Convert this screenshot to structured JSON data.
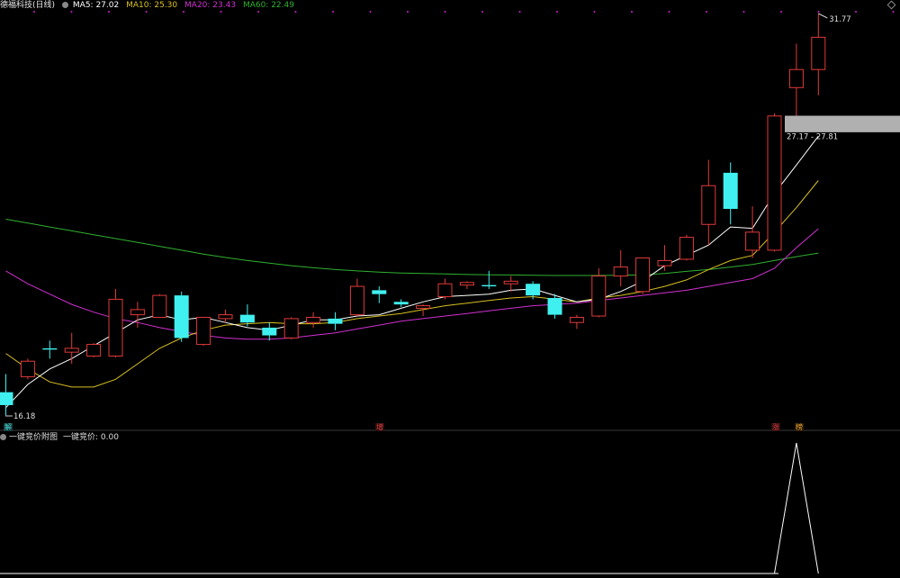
{
  "header": {
    "stock_title": "德福科技(日线)",
    "ma5": "MA5: 27.02",
    "ma10": "MA10: 25.30",
    "ma20": "MA20: 23.43",
    "ma60": "MA60: 22.49"
  },
  "colors": {
    "up": "#e03a3a",
    "down": "#40f0f0",
    "ma5": "#ffffff",
    "ma10": "#d8c020",
    "ma20": "#d030d0",
    "ma60": "#30b030",
    "grid_dot": "#cc22cc",
    "band": "#b0b0b0"
  },
  "annotations": {
    "high_label": "31.77",
    "low_label": "16.18",
    "band_label": "27.17 - 27.81"
  },
  "markers": {
    "left": "解",
    "mid": "增",
    "right1": "涨",
    "right2": "榜"
  },
  "sub_panel": {
    "title": "一键竞价附图",
    "value_label": "一键竞价: 0.00"
  },
  "chart_data": {
    "type": "candlestick",
    "y_range": [
      16.18,
      31.77
    ],
    "candles": [
      {
        "o": 17.1,
        "h": 17.8,
        "l": 16.2,
        "c": 16.6
      },
      {
        "o": 17.7,
        "h": 18.4,
        "l": 17.6,
        "c": 18.3
      },
      {
        "o": 18.8,
        "h": 19.1,
        "l": 18.4,
        "c": 18.75
      },
      {
        "o": 18.65,
        "h": 19.4,
        "l": 18.2,
        "c": 18.8
      },
      {
        "o": 18.5,
        "h": 19.0,
        "l": 18.45,
        "c": 18.95
      },
      {
        "o": 18.5,
        "h": 21.1,
        "l": 18.45,
        "c": 20.7
      },
      {
        "o": 20.1,
        "h": 20.6,
        "l": 19.6,
        "c": 20.3
      },
      {
        "o": 20.0,
        "h": 20.9,
        "l": 20.0,
        "c": 20.85
      },
      {
        "o": 20.85,
        "h": 21.0,
        "l": 19.05,
        "c": 19.2
      },
      {
        "o": 18.95,
        "h": 20.0,
        "l": 18.9,
        "c": 20.0
      },
      {
        "o": 19.95,
        "h": 20.3,
        "l": 19.8,
        "c": 20.1
      },
      {
        "o": 20.1,
        "h": 20.5,
        "l": 19.65,
        "c": 19.8
      },
      {
        "o": 19.6,
        "h": 19.8,
        "l": 19.1,
        "c": 19.3
      },
      {
        "o": 19.2,
        "h": 20.0,
        "l": 19.15,
        "c": 19.95
      },
      {
        "o": 19.8,
        "h": 20.2,
        "l": 19.6,
        "c": 20.0
      },
      {
        "o": 19.95,
        "h": 20.2,
        "l": 19.5,
        "c": 19.75
      },
      {
        "o": 20.1,
        "h": 21.5,
        "l": 20.05,
        "c": 21.2
      },
      {
        "o": 21.05,
        "h": 21.2,
        "l": 20.55,
        "c": 20.9
      },
      {
        "o": 20.6,
        "h": 20.7,
        "l": 20.4,
        "c": 20.5
      },
      {
        "o": 20.35,
        "h": 20.5,
        "l": 20.05,
        "c": 20.45
      },
      {
        "o": 20.8,
        "h": 21.5,
        "l": 20.7,
        "c": 21.3
      },
      {
        "o": 21.25,
        "h": 21.4,
        "l": 21.1,
        "c": 21.35
      },
      {
        "o": 21.25,
        "h": 21.8,
        "l": 21.1,
        "c": 21.2
      },
      {
        "o": 21.3,
        "h": 21.6,
        "l": 21.0,
        "c": 21.4
      },
      {
        "o": 21.3,
        "h": 21.4,
        "l": 20.7,
        "c": 20.85
      },
      {
        "o": 20.75,
        "h": 20.9,
        "l": 19.95,
        "c": 20.1
      },
      {
        "o": 19.8,
        "h": 20.1,
        "l": 19.55,
        "c": 20.0
      },
      {
        "o": 20.05,
        "h": 21.9,
        "l": 20.0,
        "c": 21.6
      },
      {
        "o": 21.6,
        "h": 22.6,
        "l": 21.2,
        "c": 21.95
      },
      {
        "o": 21.0,
        "h": 22.3,
        "l": 20.9,
        "c": 22.3
      },
      {
        "o": 22.0,
        "h": 22.8,
        "l": 21.8,
        "c": 22.2
      },
      {
        "o": 22.25,
        "h": 23.2,
        "l": 22.2,
        "c": 23.1
      },
      {
        "o": 23.6,
        "h": 26.1,
        "l": 22.8,
        "c": 25.1
      },
      {
        "o": 25.6,
        "h": 26.0,
        "l": 23.6,
        "c": 24.2
      },
      {
        "o": 22.6,
        "h": 24.3,
        "l": 22.3,
        "c": 23.3
      },
      {
        "o": 22.6,
        "h": 27.9,
        "l": 22.55,
        "c": 27.8
      },
      {
        "o": 28.9,
        "h": 30.6,
        "l": 27.5,
        "c": 29.6
      },
      {
        "o": 29.6,
        "h": 31.77,
        "l": 28.6,
        "c": 30.85
      }
    ],
    "ma5": [
      16.5,
      17.4,
      18.0,
      18.4,
      18.9,
      19.4,
      19.9,
      20.1,
      19.9,
      20.0,
      19.8,
      19.6,
      19.5,
      19.7,
      19.9,
      19.9,
      20.05,
      20.1,
      20.35,
      20.6,
      20.8,
      20.85,
      20.9,
      21.05,
      21.1,
      20.85,
      20.6,
      20.7,
      21.0,
      21.4,
      22.0,
      22.4,
      22.8,
      23.5,
      23.45,
      24.8,
      25.9,
      27.02
    ],
    "ma10": [
      18.6,
      18.0,
      17.5,
      17.3,
      17.3,
      17.6,
      18.2,
      18.8,
      19.2,
      19.5,
      19.7,
      19.75,
      19.8,
      19.75,
      19.75,
      19.8,
      19.95,
      20.05,
      20.15,
      20.3,
      20.45,
      20.55,
      20.65,
      20.75,
      20.8,
      20.7,
      20.6,
      20.75,
      20.85,
      21.0,
      21.2,
      21.45,
      21.85,
      22.2,
      22.4,
      23.3,
      24.25,
      25.3
    ],
    "ma20": [
      21.8,
      21.3,
      20.9,
      20.5,
      20.2,
      19.95,
      19.8,
      19.6,
      19.45,
      19.3,
      19.2,
      19.15,
      19.15,
      19.2,
      19.3,
      19.4,
      19.55,
      19.7,
      19.85,
      19.95,
      20.05,
      20.15,
      20.25,
      20.35,
      20.45,
      20.5,
      20.55,
      20.65,
      20.75,
      20.85,
      20.95,
      21.05,
      21.2,
      21.35,
      21.5,
      21.9,
      22.7,
      23.43
    ],
    "ma60": [
      23.8,
      23.65,
      23.5,
      23.35,
      23.2,
      23.05,
      22.9,
      22.75,
      22.6,
      22.45,
      22.32,
      22.2,
      22.1,
      22.0,
      21.92,
      21.85,
      21.8,
      21.75,
      21.72,
      21.7,
      21.68,
      21.66,
      21.65,
      21.64,
      21.63,
      21.62,
      21.62,
      21.62,
      21.63,
      21.65,
      21.7,
      21.78,
      21.85,
      21.95,
      22.05,
      22.2,
      22.35,
      22.49
    ],
    "auction": [
      0,
      0,
      0,
      0,
      0,
      0,
      0,
      0,
      0,
      0,
      0,
      0,
      0,
      0,
      0,
      0,
      0,
      0,
      0,
      0,
      0,
      0,
      0,
      0,
      0,
      0,
      0,
      0,
      0,
      0,
      0,
      0,
      0,
      0,
      0,
      0,
      1,
      0
    ]
  }
}
